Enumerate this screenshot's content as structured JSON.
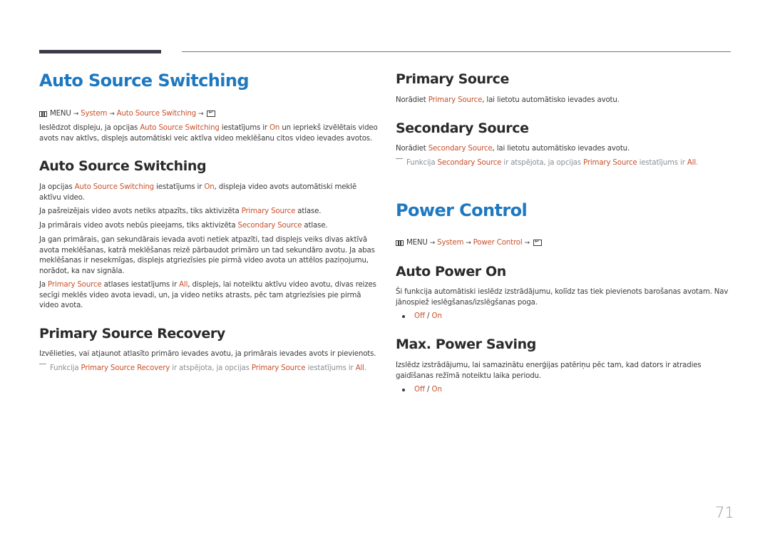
{
  "page_number": "71",
  "left": {
    "title": "Auto Source Switching",
    "menu_path": {
      "menu": "MENU",
      "arrow": "→",
      "items": [
        "System",
        "Auto Source Switching"
      ]
    },
    "intro": {
      "t1": "Ieslēdzot displeju, ja opcijas ",
      "h1": "Auto Source Switching",
      "t2": " iestatījums ir ",
      "h2": "On",
      "t3": " un iepriekš izvēlētais video avots nav aktīvs, displejs automātiski veic aktīva video meklēšanu citos video ievades avotos."
    },
    "ass_section": {
      "heading": "Auto Source Switching",
      "p1": {
        "t1": "Ja opcijas ",
        "h1": "Auto Source Switching",
        "t2": " iestatījums ir ",
        "h2": "On",
        "t3": ", displeja video avots automātiski meklē aktīvu video."
      },
      "p2": {
        "t1": "Ja pašreizējais video avots netiks atpazīts, tiks aktivizēta ",
        "h1": "Primary Source",
        "t2": " atlase."
      },
      "p3": {
        "t1": "Ja primārais video avots nebūs pieejams, tiks aktivizēta ",
        "h1": "Secondary Source",
        "t2": " atlase."
      },
      "p4": "Ja gan primārais, gan sekundārais ievada avoti netiek atpazīti, tad displejs veiks divas aktīvā avota meklēšanas, katrā meklēšanas reizē pārbaudot primāro un tad sekundāro avotu. Ja abas meklēšanas ir nesekmīgas, displejs atgriezīsies pie pirmā video avota un attēlos paziņojumu, norādot, ka nav signāla.",
      "p5": {
        "t1": "Ja ",
        "h1": "Primary Source",
        "t2": " atlases iestatījums ir ",
        "h2": "All",
        "t3": ", displejs, lai noteiktu aktīvu video avotu, divas reizes secīgi meklēs video avota ievadi, un, ja video netiks atrasts, pēc tam atgriezīsies pie pirmā video avota."
      }
    },
    "psr_section": {
      "heading": "Primary Source Recovery",
      "p1": "Izvēlieties, vai atjaunot atlasīto primāro ievades avotu, ja primārais ievades avots ir pievienots.",
      "note": {
        "t1": "Funkcija ",
        "h1": "Primary Source Recovery",
        "t2": " ir atspējota, ja opcijas ",
        "h2": "Primary Source",
        "t3": " iestatījums ir ",
        "h3": "All",
        "t4": "."
      }
    }
  },
  "right": {
    "primary_source": {
      "heading": "Primary Source",
      "p1": {
        "t1": "Norādiet ",
        "h1": "Primary Source",
        "t2": ", lai lietotu automātisko ievades avotu."
      }
    },
    "secondary_source": {
      "heading": "Secondary Source",
      "p1": {
        "t1": "Norādiet ",
        "h1": "Secondary Source",
        "t2": ", lai lietotu automātisko ievades avotu."
      },
      "note": {
        "t1": "Funkcija ",
        "h1": "Secondary Source",
        "t2": " ir atspējota, ja opcijas ",
        "h2": "Primary Source",
        "t3": " iestatījums ir ",
        "h3": "All",
        "t4": "."
      }
    },
    "power_control": {
      "title": "Power Control",
      "menu_path": {
        "menu": "MENU",
        "arrow": "→",
        "items": [
          "System",
          "Power Control"
        ]
      },
      "auto_power_on": {
        "heading": "Auto Power On",
        "p1": "Ši funkcija automātiski ieslēdz izstrādājumu, kolīdz tas tiek pievienots barošanas avotam. Nav jānospiež ieslēgšanas/izslēgšanas poga.",
        "options": [
          "Off",
          "On"
        ]
      },
      "max_power_saving": {
        "heading": "Max. Power Saving",
        "p1": "Izslēdz izstrādājumu, lai samazinātu enerģijas patēriņu pēc tam, kad dators ir atradies gaidīšanas režīmā noteiktu laika periodu.",
        "options": [
          "Off",
          "On"
        ]
      }
    }
  }
}
